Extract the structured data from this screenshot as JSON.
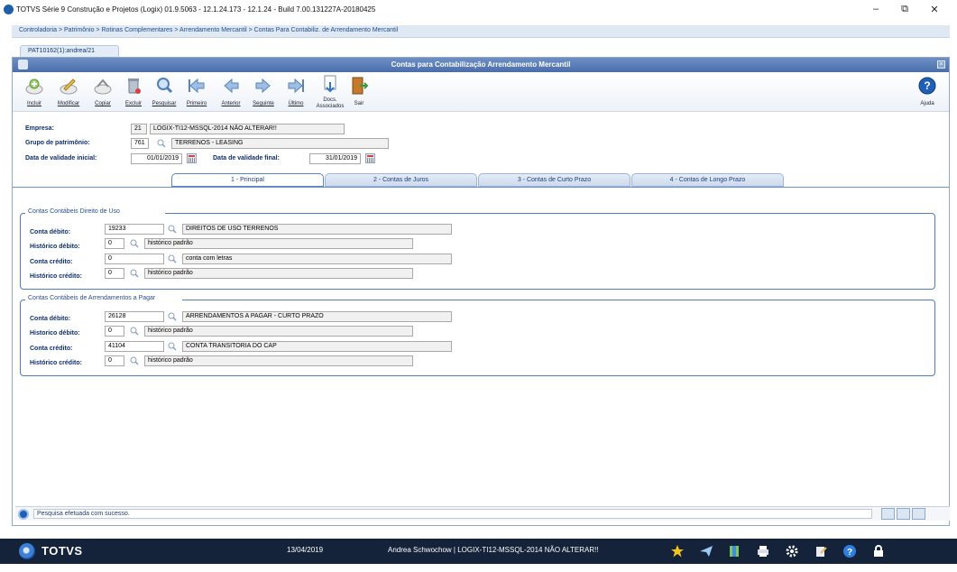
{
  "window": {
    "title": "TOTVS Série 9 Construção e Projetos (Logix) 01.9.5063 - 12.1.24.173 - 12.1.24 - Build 7.00.131227A-20180425",
    "minimize": "–",
    "restore": "⧉",
    "close": "✕"
  },
  "breadcrumb": "Controladoria > Patrimônio > Rotinas Complementares > Arrendamento Mercantil > Contas Para Contabiliz. de Arrendamento Mercantil",
  "program_tab": "PAT10162(1):andrea/21",
  "form_title": "Contas para Contabilização Arrendamento Mercantil",
  "toolbar": {
    "incluir": "Incluir",
    "modificar": "Modificar",
    "copiar": "Copiar",
    "excluir": "Excluir",
    "pesquisar": "Pesquisar",
    "primeiro": "Primeiro",
    "anterior": "Anterior",
    "seguinte": "Seguinte",
    "ultimo": "Último",
    "docs_line1": "Docs.",
    "docs_line2": "Associados",
    "sair": "Sair",
    "ajuda": "Ajuda"
  },
  "header": {
    "empresa_label": "Empresa:",
    "empresa_code": "21",
    "empresa_name": "LOGIX-TI12-MSSQL-2014 NÃO ALTERAR!!",
    "grupo_label": "Grupo de patrimônio:",
    "grupo_code": "761",
    "grupo_name": "TERRENOS - LEASING",
    "validade_ini_label": "Data de validade inicial:",
    "validade_ini": "01/01/2019",
    "validade_fim_label": "Data de validade final:",
    "validade_fim": "31/01/2019"
  },
  "tabs": [
    {
      "label": "1 - Principal"
    },
    {
      "label": "2 - Contas de Juros"
    },
    {
      "label": "3 - Contas de Curto Prazo"
    },
    {
      "label": "4 - Contas de Longo Prazo"
    }
  ],
  "group1": {
    "title": "Contas Contábeis Direito de Uso",
    "conta_debito_label": "Conta débito:",
    "conta_debito_code": "19233",
    "conta_debito_name": "DIREITOS DE USO TERRENOS",
    "hist_debito_label": "Histórico débito:",
    "hist_debito_code": "0",
    "hist_debito_name": "histórico padrão",
    "conta_credito_label": "Conta crédito:",
    "conta_credito_code": "0",
    "conta_credito_name": "conta com letras",
    "hist_credito_label": "Histórico crédito:",
    "hist_credito_code": "0",
    "hist_credito_name": "histórico padrão"
  },
  "group2": {
    "title": "Contas Contábeis de Arrendamentos a Pagar",
    "conta_debito_label": "Conta débito:",
    "conta_debito_code": "26128",
    "conta_debito_name": "ARRENDAMENTOS A PAGAR - CURTO PRAZO",
    "hist_debito_label": "Historico débito:",
    "hist_debito_code": "0",
    "hist_debito_name": "histórico padrão",
    "conta_credito_label": "Conta crédito:",
    "conta_credito_code": "41104",
    "conta_credito_name": "CONTA TRANSITORIA DO CAP",
    "hist_credito_label": "Histórico crédito:",
    "hist_credito_code": "0",
    "hist_credito_name": "histórico padrão"
  },
  "status": "Pesquisa efetuada com sucesso.",
  "taskbar": {
    "brand": "TOTVS",
    "date": "13/04/2019",
    "user": "Andrea Schwochow | LOGIX-TI12-MSSQL-2014 NÃO ALTERAR!!"
  },
  "colors": {
    "accent": "#4a6eaa",
    "label": "#0e2f70",
    "taskbar": "#14223a"
  }
}
